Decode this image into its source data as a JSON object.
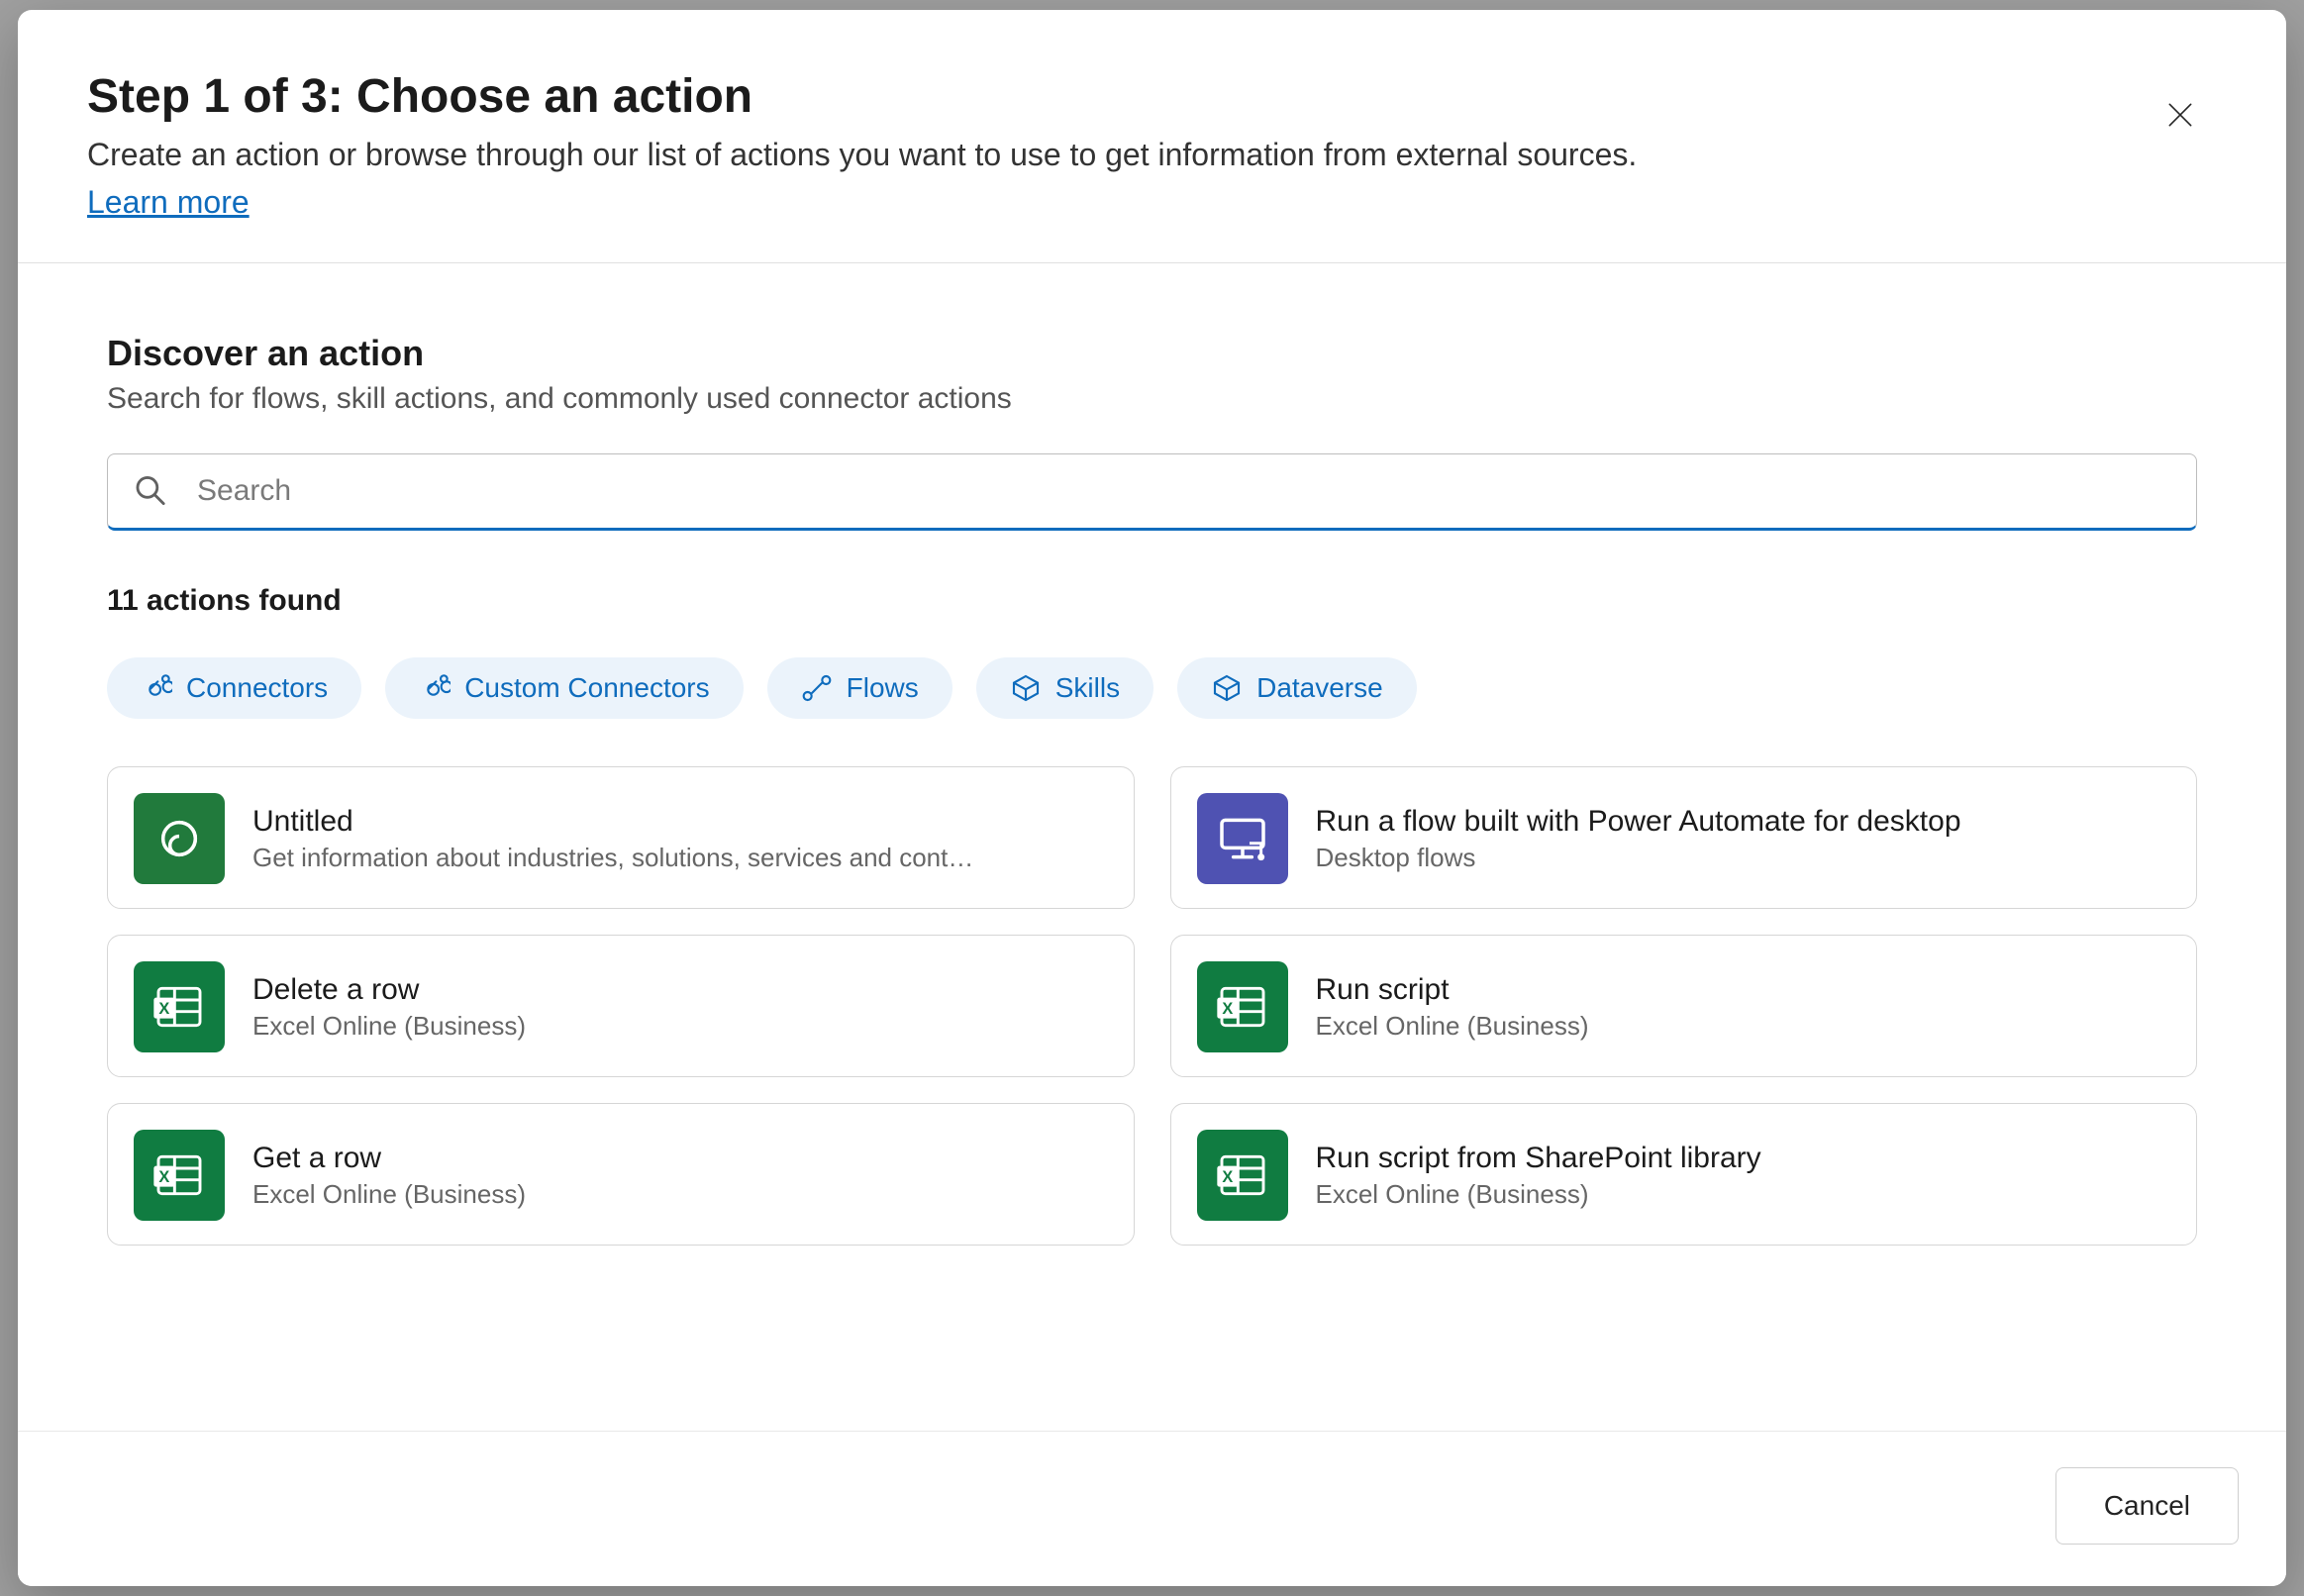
{
  "header": {
    "title": "Step 1 of 3: Choose an action",
    "description": "Create an action or browse through our list of actions you want to use to get information from external sources.",
    "learn_more": "Learn more"
  },
  "discover": {
    "title": "Discover an action",
    "subtitle": "Search for flows, skill actions, and commonly used connector actions",
    "search_placeholder": "Search",
    "found_label": "11 actions found"
  },
  "filters": [
    {
      "label": "Connectors",
      "icon": "connector"
    },
    {
      "label": "Custom Connectors",
      "icon": "connector"
    },
    {
      "label": "Flows",
      "icon": "flow"
    },
    {
      "label": "Skills",
      "icon": "cube"
    },
    {
      "label": "Dataverse",
      "icon": "cube"
    }
  ],
  "actions": [
    {
      "title": "Untitled",
      "subtitle": "Get information about industries, solutions, services and cont…",
      "icon": "swirl",
      "color": "brand"
    },
    {
      "title": "Run a flow built with Power Automate for desktop",
      "subtitle": "Desktop flows",
      "icon": "desktop-flow",
      "color": "blue"
    },
    {
      "title": "Delete a row",
      "subtitle": "Excel Online (Business)",
      "icon": "excel",
      "color": "green"
    },
    {
      "title": "Run script",
      "subtitle": "Excel Online (Business)",
      "icon": "excel",
      "color": "green"
    },
    {
      "title": "Get a row",
      "subtitle": "Excel Online (Business)",
      "icon": "excel",
      "color": "green"
    },
    {
      "title": "Run script from SharePoint library",
      "subtitle": "Excel Online (Business)",
      "icon": "excel",
      "color": "green"
    }
  ],
  "footer": {
    "cancel": "Cancel"
  }
}
